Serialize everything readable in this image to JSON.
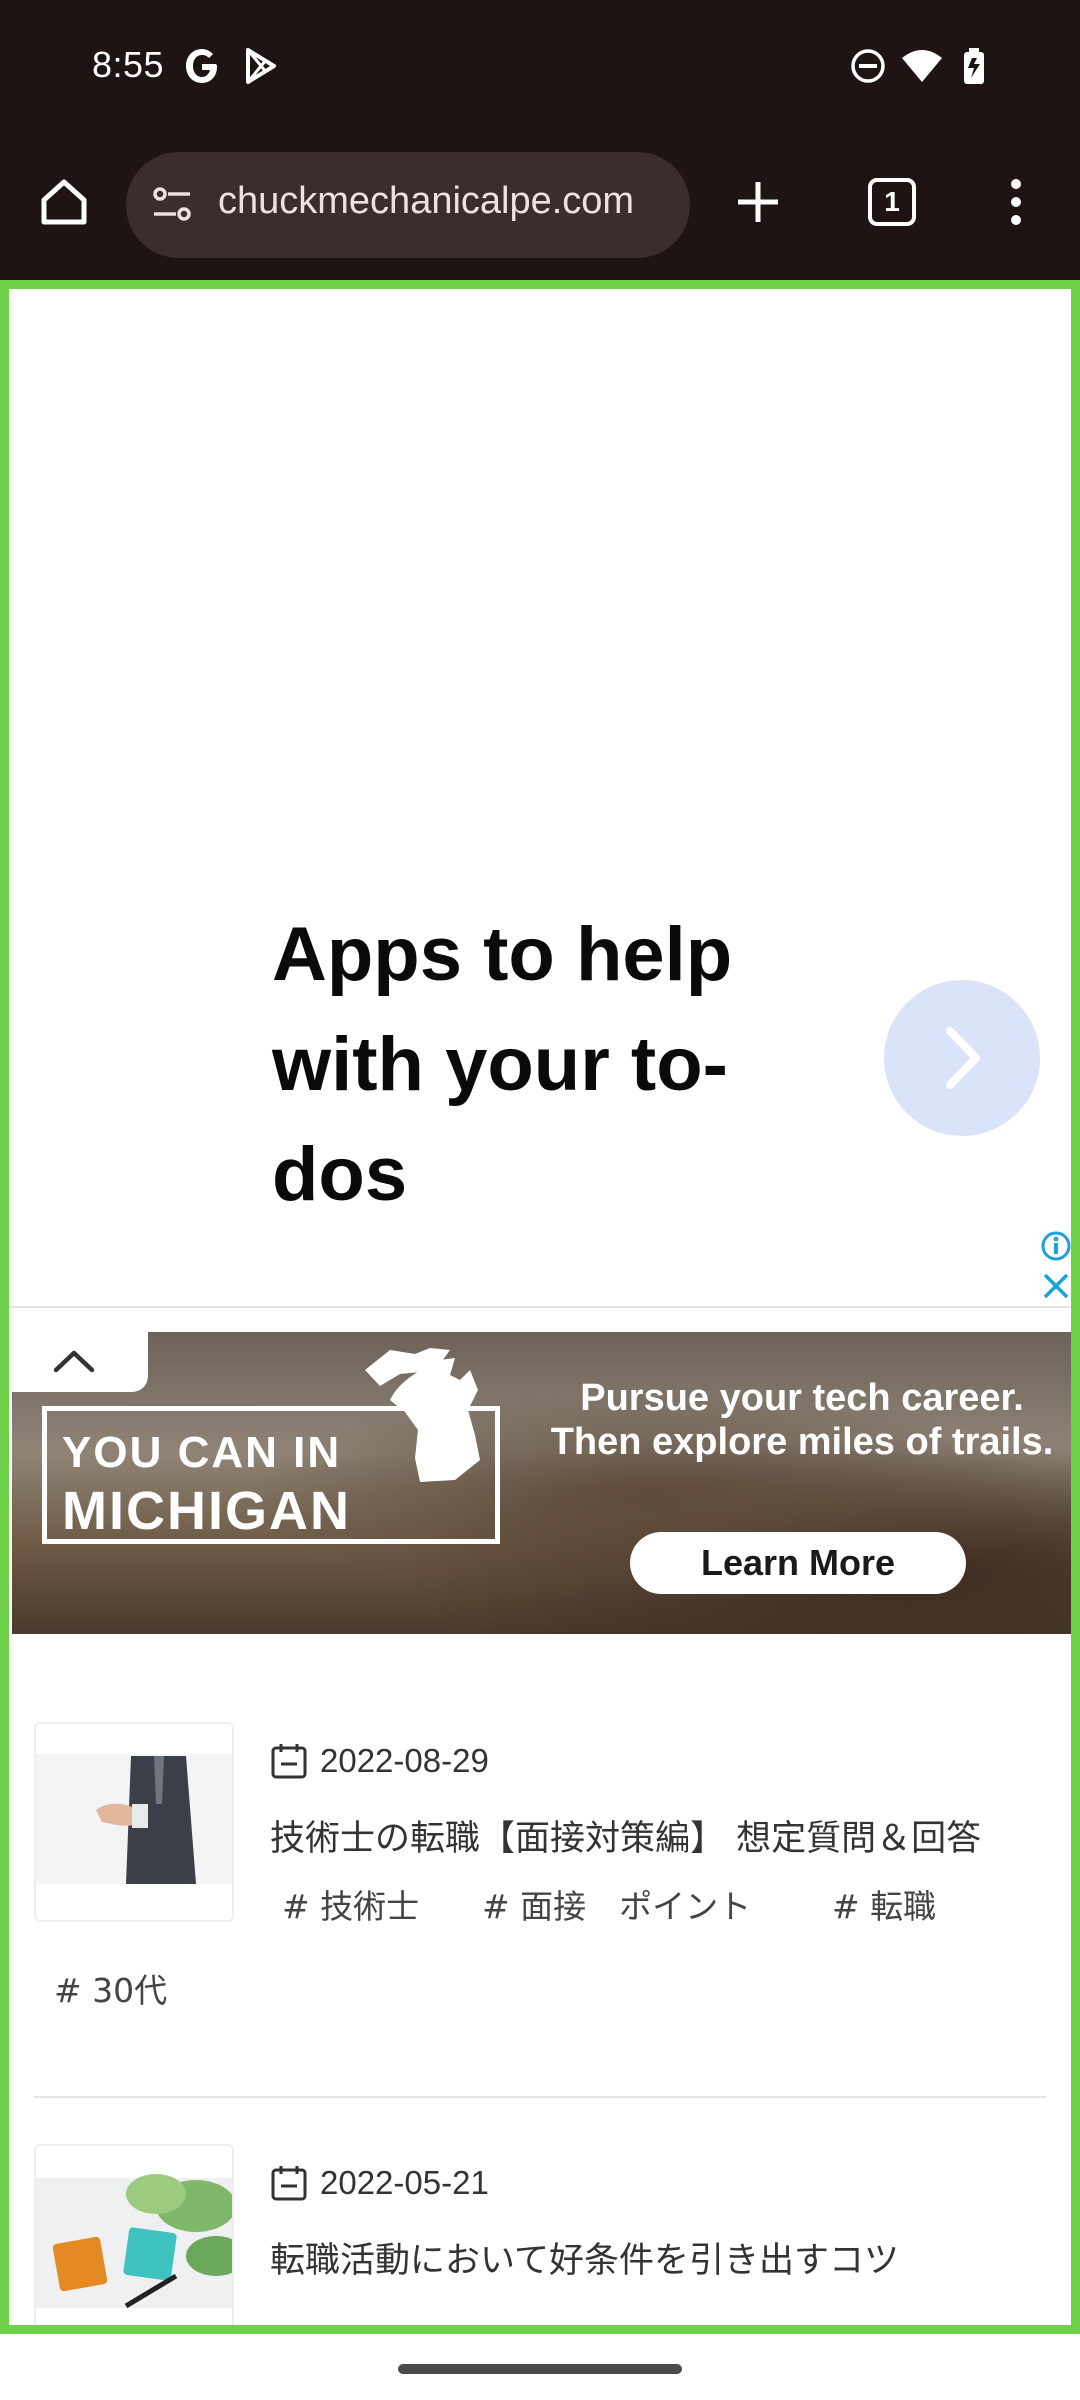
{
  "status_bar": {
    "time": "8:55",
    "left_icons": [
      "google-g-icon",
      "play-store-icon"
    ],
    "right_icons": [
      "do-not-disturb-icon",
      "wifi-icon",
      "battery-icon"
    ]
  },
  "browser": {
    "url": "chuckmechanicalpe.com",
    "tab_count": "1",
    "icons": [
      "home-icon",
      "site-settings-icon",
      "new-tab-icon",
      "tab-switcher-icon",
      "more-menu-icon"
    ]
  },
  "ads": {
    "ad1": {
      "headline": "Apps to help with your to-dos",
      "icons": [
        "chevron-right-icon",
        "ad-info-icon",
        "ad-close-icon"
      ]
    },
    "ad2": {
      "brand_line1": "YOU CAN IN",
      "brand_line2": "MICHIGAN",
      "headline": "Pursue your tech career. Then explore miles of trails.",
      "cta": "Learn More"
    }
  },
  "posts": [
    {
      "date": "2022-08-29",
      "title": "技術士の転職【面接対策編】 想定質問＆回答",
      "tags": [
        "# 技術士",
        "# 面接　ポイント",
        "# 転職",
        "# 30代"
      ]
    },
    {
      "date": "2022-05-21",
      "title": "転職活動において好条件を引き出すコツ",
      "tags": []
    }
  ],
  "colors": {
    "system_bar": "#1f1414",
    "url_pill": "#3a2d2c",
    "highlight_border": "#6ed148",
    "ad_button": "#dbe3fb",
    "ad_icon_blue": "#1aa3d9"
  }
}
